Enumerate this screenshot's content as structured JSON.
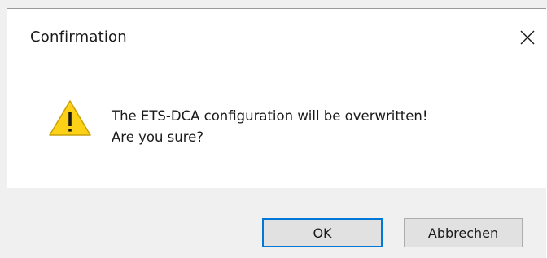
{
  "dialog": {
    "title": "Confirmation",
    "close_icon": "close-icon",
    "icon": "warning-icon",
    "message_line1": "The ETS-DCA configuration will be overwritten!",
    "message_line2": "Are you sure?",
    "ok_label": "OK",
    "cancel_label": "Abbrechen"
  },
  "colors": {
    "warning_fill": "#fcd116",
    "warning_stroke": "#c9a00a",
    "focus_border": "#0078d7",
    "footer_bg": "#f0f0f0"
  }
}
